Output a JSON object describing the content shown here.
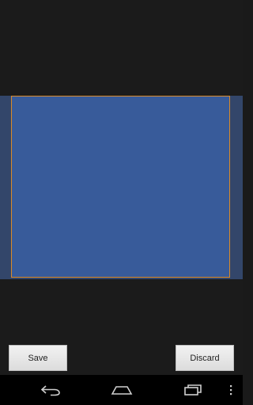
{
  "buttons": {
    "save_label": "Save",
    "discard_label": "Discard"
  },
  "navbar": {
    "back_icon": "back-arrow-icon",
    "home_icon": "home-icon",
    "recents_icon": "recent-apps-icon",
    "menu_icon": "overflow-menu-icon"
  },
  "colors": {
    "background": "#1b1b1b",
    "image_band": "#33466a",
    "crop_fill": "#385b9a",
    "crop_border": "#d98a2a"
  }
}
